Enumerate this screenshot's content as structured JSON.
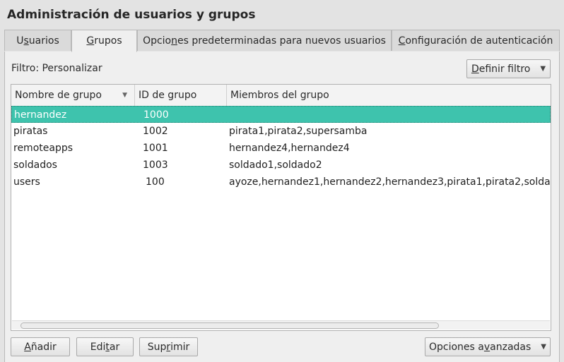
{
  "window": {
    "title": "Administración de usuarios y grupos"
  },
  "tabs": [
    {
      "label_pre": "U",
      "label_u": "s",
      "label_post": "uarios",
      "active": false
    },
    {
      "label_pre": "",
      "label_u": "G",
      "label_post": "rupos",
      "active": true
    },
    {
      "label_pre": "Opcio",
      "label_u": "n",
      "label_post": "es predeterminadas para nuevos usuarios",
      "active": false
    },
    {
      "label_pre": "",
      "label_u": "C",
      "label_post": "onfiguración de autenticación",
      "active": false
    }
  ],
  "filter": {
    "label": "Filtro: Personalizar",
    "button_pre": "",
    "button_u": "D",
    "button_post": "efinir filtro"
  },
  "table": {
    "columns": [
      "Nombre de grupo",
      "ID de grupo",
      "Miembros del grupo"
    ],
    "sorted_column": "Nombre de grupo",
    "sort_indicator": "▼",
    "rows": [
      {
        "name": "hernandez",
        "id": "1000",
        "members": ""
      },
      {
        "name": "piratas",
        "id": "1002",
        "members": "pirata1,pirata2,supersamba"
      },
      {
        "name": "remoteapps",
        "id": "1001",
        "members": "hernandez4,hernandez4"
      },
      {
        "name": "soldados",
        "id": "1003",
        "members": "soldado1,soldado2"
      },
      {
        "name": "users",
        "id": "100",
        "members": "ayoze,hernandez1,hernandez2,hernandez3,pirata1,pirata2,solda"
      }
    ],
    "selected_row": 0
  },
  "buttons": {
    "add": {
      "pre": "",
      "u": "A",
      "post": "ñadir"
    },
    "edit": {
      "pre": "Edi",
      "u": "t",
      "post": "ar"
    },
    "delete": {
      "pre": "Sup",
      "u": "r",
      "post": "imir"
    },
    "advanced": {
      "pre": "Opciones a",
      "u": "v",
      "post": "anzadas"
    }
  },
  "colors": {
    "selection": "#3ec3ad",
    "window_bg": "#e3e3e3",
    "panel_bg": "#efefef"
  }
}
